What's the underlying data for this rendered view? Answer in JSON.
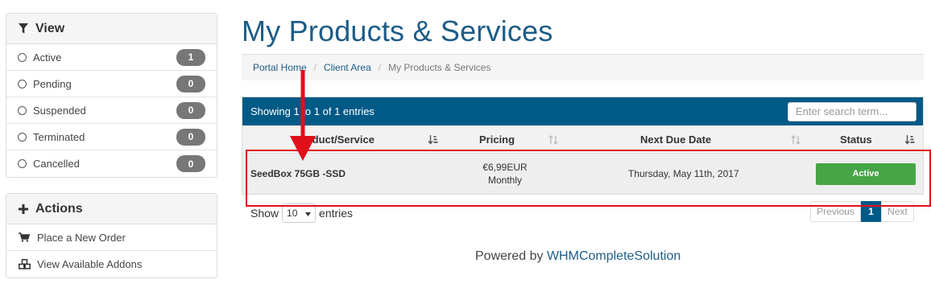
{
  "sidebar": {
    "view_title": "View",
    "view_items": [
      {
        "label": "Active",
        "count": "1"
      },
      {
        "label": "Pending",
        "count": "0"
      },
      {
        "label": "Suspended",
        "count": "0"
      },
      {
        "label": "Terminated",
        "count": "0"
      },
      {
        "label": "Cancelled",
        "count": "0"
      }
    ],
    "actions_title": "Actions",
    "actions_items": [
      {
        "label": "Place a New Order",
        "icon": "cart-icon"
      },
      {
        "label": "View Available Addons",
        "icon": "cubes-icon"
      }
    ]
  },
  "page": {
    "title": "My Products & Services"
  },
  "breadcrumb": {
    "items": [
      "Portal Home",
      "Client Area",
      "My Products & Services"
    ]
  },
  "table": {
    "info": "Showing 1 to 1 of 1 entries",
    "search_placeholder": "Enter search term...",
    "columns": [
      "Product/Service",
      "Pricing",
      "Next Due Date",
      "Status"
    ],
    "rows": [
      {
        "product": "SeedBox 75GB -SSD",
        "price": "€6,99EUR",
        "cycle": "Monthly",
        "due": "Thursday, May 11th, 2017",
        "status": "Active"
      }
    ]
  },
  "length_control": {
    "show": "Show",
    "value": "10",
    "entries": "entries"
  },
  "pagination": {
    "previous": "Previous",
    "current": "1",
    "next": "Next"
  },
  "footer": {
    "prefix": "Powered by",
    "link": "WHMCompleteSolution"
  },
  "colors": {
    "brand": "#005a86",
    "title": "#1d5c86",
    "status_active": "#46a546",
    "annotation": "#e0101a"
  }
}
